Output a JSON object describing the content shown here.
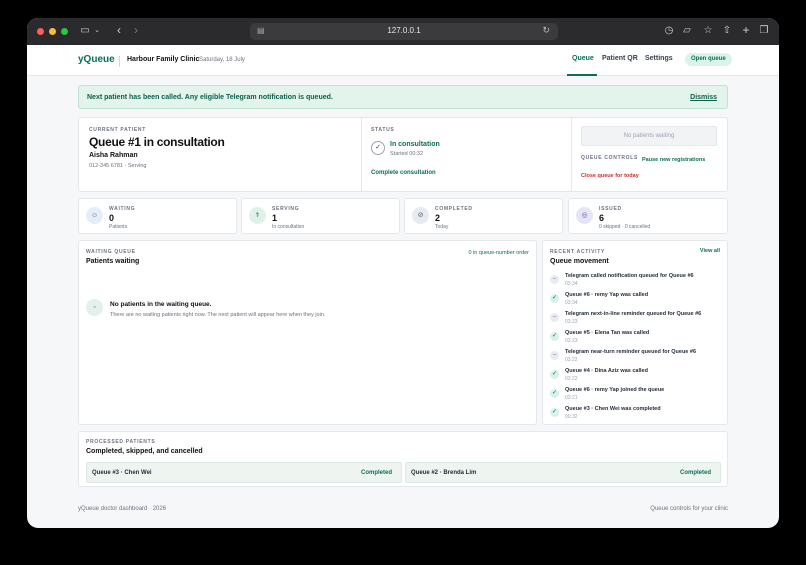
{
  "browser": {
    "url": "127.0.0.1"
  },
  "header": {
    "logo": "yQueue",
    "clinic_name": "Harbour Family Clinic",
    "date": "Saturday, 18 July",
    "nav": [
      {
        "label": "Queue"
      },
      {
        "label": "Patient QR"
      },
      {
        "label": "Settings"
      }
    ],
    "open_queue_label": "Open queue"
  },
  "alert": {
    "message": "Next patient has been called. Any eligible Telegram notification is queued.",
    "dismiss_label": "Dismiss"
  },
  "current_patient": {
    "label": "CURRENT PATIENT",
    "heading": "Queue #1 in consultation",
    "name": "Aisha Rahman",
    "meta": "012-345 6781 · Serving"
  },
  "status": {
    "label": "STATUS",
    "state": "In consultation",
    "started": "Started 00:32",
    "complete_label": "Complete consultation"
  },
  "queue_controls": {
    "no_patients_button": "No patients waiting",
    "label": "QUEUE CONTROLS",
    "pause_label": "Pause new registrations",
    "close_label": "Close queue for today"
  },
  "stats": [
    {
      "label": "WAITING",
      "value": "0",
      "sub": "Patients",
      "color": "#e5edf6"
    },
    {
      "label": "SERVING",
      "value": "1",
      "sub": "In consultation",
      "color": "#dff2e9"
    },
    {
      "label": "COMPLETED",
      "value": "2",
      "sub": "Today",
      "color": "#e6ebf2"
    },
    {
      "label": "ISSUED",
      "value": "6",
      "sub": "0 skipped · 0 cancelled",
      "color": "#e6e5f5"
    }
  ],
  "waiting_queue": {
    "label": "WAITING QUEUE",
    "title": "Patients waiting",
    "order_note": "0 in queue-number order",
    "empty_title": "No patients in the waiting queue.",
    "empty_text": "There are no waiting patients right now. The next patient will appear here when they join."
  },
  "activity": {
    "label": "RECENT ACTIVITY",
    "title": "Queue movement",
    "view_all": "View all",
    "items": [
      {
        "text": "Telegram called notification queued for Queue #6",
        "time": "03:34",
        "kind": "info"
      },
      {
        "text": "Queue #6 · remy Yap was called",
        "time": "03:34",
        "kind": "done"
      },
      {
        "text": "Telegram next-in-line reminder queued for Queue #6",
        "time": "03:23",
        "kind": "info"
      },
      {
        "text": "Queue #5 · Elena Tan was called",
        "time": "03:23",
        "kind": "done"
      },
      {
        "text": "Telegram near-turn reminder queued for Queue #6",
        "time": "03:22",
        "kind": "info"
      },
      {
        "text": "Queue #4 · Dina Aziz was called",
        "time": "03:22",
        "kind": "done"
      },
      {
        "text": "Queue #6 · remy Yap joined the queue",
        "time": "03:21",
        "kind": "done"
      },
      {
        "text": "Queue #3 · Chen Wei was completed",
        "time": "00:32",
        "kind": "done"
      }
    ]
  },
  "processed": {
    "label": "PROCESSED PATIENTS",
    "title": "Completed, skipped, and cancelled",
    "items": [
      {
        "name": "Queue #3 · Chen Wei",
        "status": "Completed"
      },
      {
        "name": "Queue #2 · Brenda Lim",
        "status": "Completed"
      }
    ]
  },
  "footer": {
    "left": "yQueue doctor dashboard · 2026",
    "right": "Queue controls for your clinic"
  }
}
